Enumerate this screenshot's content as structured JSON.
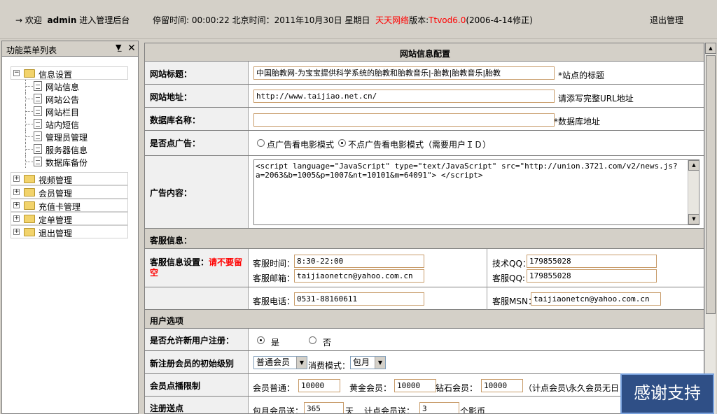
{
  "topbar": {
    "welcome_prefix": "→ 欢迎",
    "username": "admin",
    "welcome_suffix": "进入管理后台",
    "stay_text": "停留时间: 00:00:22   北京时间：2011年10月30日  星期日",
    "site_name": "天天网络",
    "version_label": "版本:",
    "version": "Ttvod6.0",
    "version_date": "(2006-4-14修正)",
    "logout": "退出管理"
  },
  "sidebar": {
    "title": "功能菜单列表",
    "groups": [
      {
        "label": "信息设置",
        "expanded": true,
        "items": [
          "网站信息",
          "网站公告",
          "网站栏目",
          "站内短信",
          "管理员管理",
          "服务器信息",
          "数据库备份"
        ]
      },
      {
        "label": "视频管理"
      },
      {
        "label": "会员管理"
      },
      {
        "label": "充值卡管理"
      },
      {
        "label": "定单管理"
      },
      {
        "label": "退出管理"
      }
    ]
  },
  "config": {
    "title": "网站信息配置",
    "site_title_label": "网站标题：",
    "site_title_value": "中国胎教网-为宝宝提供科学系统的胎教和胎教音乐|-胎教|胎教音乐|胎教",
    "site_title_note": "*站点的标题",
    "site_url_label": "网站地址：",
    "site_url_value": "http://www.taijiao.net.cn/",
    "site_url_note": "请添写完整URL地址",
    "db_label": "数据库名称：",
    "db_value": "",
    "db_note": "*数据库地址",
    "ad_label": "是否点广告：",
    "ad_opt1": "点广告看电影模式",
    "ad_opt2": "不点广告看电影模式（需要用户ＩＤ）",
    "adcontent_label": "广告内容：",
    "adcontent_value": "<script language=\"JavaScript\" type=\"text/JavaScript\" src=\"http://union.3721.com/v2/news.js?a=2063&b=1005&p=1007&nt=10101&m=64091\"> </script>",
    "service_section": "客服信息：",
    "service_label": "客服信息设置：",
    "service_warn": "请不要留空",
    "service_time_label": "客服时间：",
    "service_time": "8:30-22:00",
    "service_email_label": "客服邮箱：",
    "service_email": "taijiaonetcn@yahoo.com.cn",
    "tech_qq_label": "技术QQ：",
    "tech_qq": "179855028",
    "service_qq_label": "客服QQ:",
    "service_qq": "179855028",
    "service_phone_label": "客服电话：",
    "service_phone": "0531-88160611",
    "service_msn_label": "客服MSN：",
    "service_msn": "taijiaonetcn@yahoo.com.cn",
    "user_section": "用户选项",
    "reg_label": "是否允许新用户注册：",
    "reg_yes": "是",
    "reg_no": "否",
    "level_label": "新注册会员的初始级别",
    "level_value": "普通会员",
    "mode_label": "消费模式：",
    "mode_value": "包月",
    "limit_label": "会员点播限制",
    "normal_label": "会员普通：",
    "normal_value": "10000",
    "gold_label": "黄金会员：",
    "gold_value": "10000",
    "diamond_label": "钻石会员：",
    "diamond_value": "10000",
    "limit_note": "（计点会员\\永久会员无日",
    "gift_label": "注册送点",
    "monthly_label": "包月会员送：",
    "monthly_value": "365",
    "monthly_unit": "天",
    "point_label": "计点会员送：",
    "point_value": "3",
    "point_unit": "个影币"
  },
  "thanks": "感谢支持",
  "colors": {
    "accent_red": "#ff0000",
    "panel_bg": "#d4d0c8",
    "input_border": "#c89c6a"
  }
}
